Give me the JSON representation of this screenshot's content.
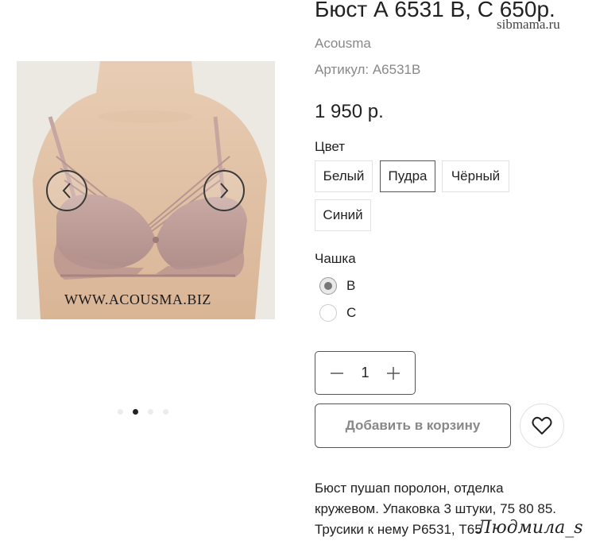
{
  "product": {
    "title": "Бюст А 6531 В, С 650р.",
    "brand": "Acousma",
    "sku": "Артикул: A6531B",
    "price": "1 950 р."
  },
  "site_mark": "sibmama.ru",
  "gallery": {
    "watermark": "WWW.ACOUSMA.BIZ",
    "active_slide": 2,
    "slide_count": 4
  },
  "color": {
    "label": "Цвет",
    "options": [
      "Белый",
      "Пудра",
      "Чёрный",
      "Синий"
    ],
    "selected": "Пудра"
  },
  "cup": {
    "label": "Чашка",
    "options": [
      "B",
      "C"
    ],
    "selected": "B"
  },
  "quantity": {
    "value": "1"
  },
  "actions": {
    "add_to_cart": "Добавить в корзину"
  },
  "description": {
    "lines": [
      "Бюст пушап поролон, отделка",
      "кружевом. Упаковка 3 штуки, 75 80 85.",
      "Трусики к нему Р6531, Т65"
    ]
  },
  "signature": "Людмила_s",
  "icons": {
    "prev": "chevron-left-icon",
    "next": "chevron-right-icon",
    "minus": "minus-icon",
    "plus": "plus-icon",
    "favorite": "heart-icon"
  }
}
